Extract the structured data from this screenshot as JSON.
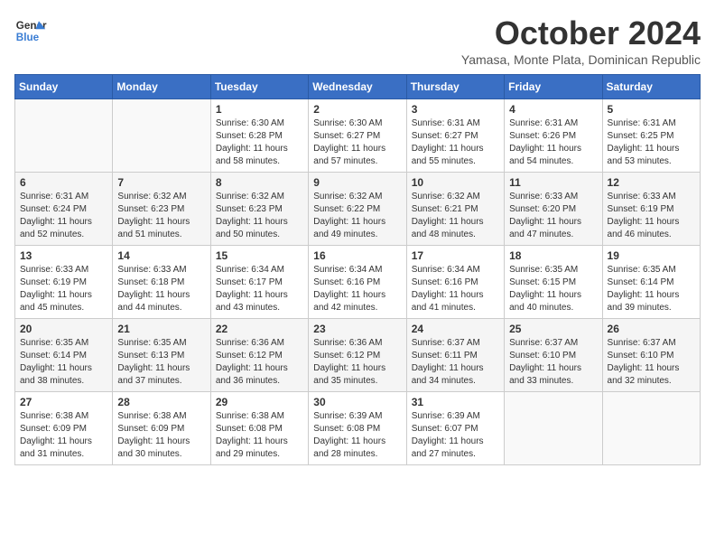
{
  "logo": {
    "line1": "General",
    "line2": "Blue"
  },
  "title": "October 2024",
  "subtitle": "Yamasa, Monte Plata, Dominican Republic",
  "days_header": [
    "Sunday",
    "Monday",
    "Tuesday",
    "Wednesday",
    "Thursday",
    "Friday",
    "Saturday"
  ],
  "weeks": [
    [
      {
        "day": "",
        "info": ""
      },
      {
        "day": "",
        "info": ""
      },
      {
        "day": "1",
        "info": "Sunrise: 6:30 AM\nSunset: 6:28 PM\nDaylight: 11 hours and 58 minutes."
      },
      {
        "day": "2",
        "info": "Sunrise: 6:30 AM\nSunset: 6:27 PM\nDaylight: 11 hours and 57 minutes."
      },
      {
        "day": "3",
        "info": "Sunrise: 6:31 AM\nSunset: 6:27 PM\nDaylight: 11 hours and 55 minutes."
      },
      {
        "day": "4",
        "info": "Sunrise: 6:31 AM\nSunset: 6:26 PM\nDaylight: 11 hours and 54 minutes."
      },
      {
        "day": "5",
        "info": "Sunrise: 6:31 AM\nSunset: 6:25 PM\nDaylight: 11 hours and 53 minutes."
      }
    ],
    [
      {
        "day": "6",
        "info": "Sunrise: 6:31 AM\nSunset: 6:24 PM\nDaylight: 11 hours and 52 minutes."
      },
      {
        "day": "7",
        "info": "Sunrise: 6:32 AM\nSunset: 6:23 PM\nDaylight: 11 hours and 51 minutes."
      },
      {
        "day": "8",
        "info": "Sunrise: 6:32 AM\nSunset: 6:23 PM\nDaylight: 11 hours and 50 minutes."
      },
      {
        "day": "9",
        "info": "Sunrise: 6:32 AM\nSunset: 6:22 PM\nDaylight: 11 hours and 49 minutes."
      },
      {
        "day": "10",
        "info": "Sunrise: 6:32 AM\nSunset: 6:21 PM\nDaylight: 11 hours and 48 minutes."
      },
      {
        "day": "11",
        "info": "Sunrise: 6:33 AM\nSunset: 6:20 PM\nDaylight: 11 hours and 47 minutes."
      },
      {
        "day": "12",
        "info": "Sunrise: 6:33 AM\nSunset: 6:19 PM\nDaylight: 11 hours and 46 minutes."
      }
    ],
    [
      {
        "day": "13",
        "info": "Sunrise: 6:33 AM\nSunset: 6:19 PM\nDaylight: 11 hours and 45 minutes."
      },
      {
        "day": "14",
        "info": "Sunrise: 6:33 AM\nSunset: 6:18 PM\nDaylight: 11 hours and 44 minutes."
      },
      {
        "day": "15",
        "info": "Sunrise: 6:34 AM\nSunset: 6:17 PM\nDaylight: 11 hours and 43 minutes."
      },
      {
        "day": "16",
        "info": "Sunrise: 6:34 AM\nSunset: 6:16 PM\nDaylight: 11 hours and 42 minutes."
      },
      {
        "day": "17",
        "info": "Sunrise: 6:34 AM\nSunset: 6:16 PM\nDaylight: 11 hours and 41 minutes."
      },
      {
        "day": "18",
        "info": "Sunrise: 6:35 AM\nSunset: 6:15 PM\nDaylight: 11 hours and 40 minutes."
      },
      {
        "day": "19",
        "info": "Sunrise: 6:35 AM\nSunset: 6:14 PM\nDaylight: 11 hours and 39 minutes."
      }
    ],
    [
      {
        "day": "20",
        "info": "Sunrise: 6:35 AM\nSunset: 6:14 PM\nDaylight: 11 hours and 38 minutes."
      },
      {
        "day": "21",
        "info": "Sunrise: 6:35 AM\nSunset: 6:13 PM\nDaylight: 11 hours and 37 minutes."
      },
      {
        "day": "22",
        "info": "Sunrise: 6:36 AM\nSunset: 6:12 PM\nDaylight: 11 hours and 36 minutes."
      },
      {
        "day": "23",
        "info": "Sunrise: 6:36 AM\nSunset: 6:12 PM\nDaylight: 11 hours and 35 minutes."
      },
      {
        "day": "24",
        "info": "Sunrise: 6:37 AM\nSunset: 6:11 PM\nDaylight: 11 hours and 34 minutes."
      },
      {
        "day": "25",
        "info": "Sunrise: 6:37 AM\nSunset: 6:10 PM\nDaylight: 11 hours and 33 minutes."
      },
      {
        "day": "26",
        "info": "Sunrise: 6:37 AM\nSunset: 6:10 PM\nDaylight: 11 hours and 32 minutes."
      }
    ],
    [
      {
        "day": "27",
        "info": "Sunrise: 6:38 AM\nSunset: 6:09 PM\nDaylight: 11 hours and 31 minutes."
      },
      {
        "day": "28",
        "info": "Sunrise: 6:38 AM\nSunset: 6:09 PM\nDaylight: 11 hours and 30 minutes."
      },
      {
        "day": "29",
        "info": "Sunrise: 6:38 AM\nSunset: 6:08 PM\nDaylight: 11 hours and 29 minutes."
      },
      {
        "day": "30",
        "info": "Sunrise: 6:39 AM\nSunset: 6:08 PM\nDaylight: 11 hours and 28 minutes."
      },
      {
        "day": "31",
        "info": "Sunrise: 6:39 AM\nSunset: 6:07 PM\nDaylight: 11 hours and 27 minutes."
      },
      {
        "day": "",
        "info": ""
      },
      {
        "day": "",
        "info": ""
      }
    ]
  ]
}
